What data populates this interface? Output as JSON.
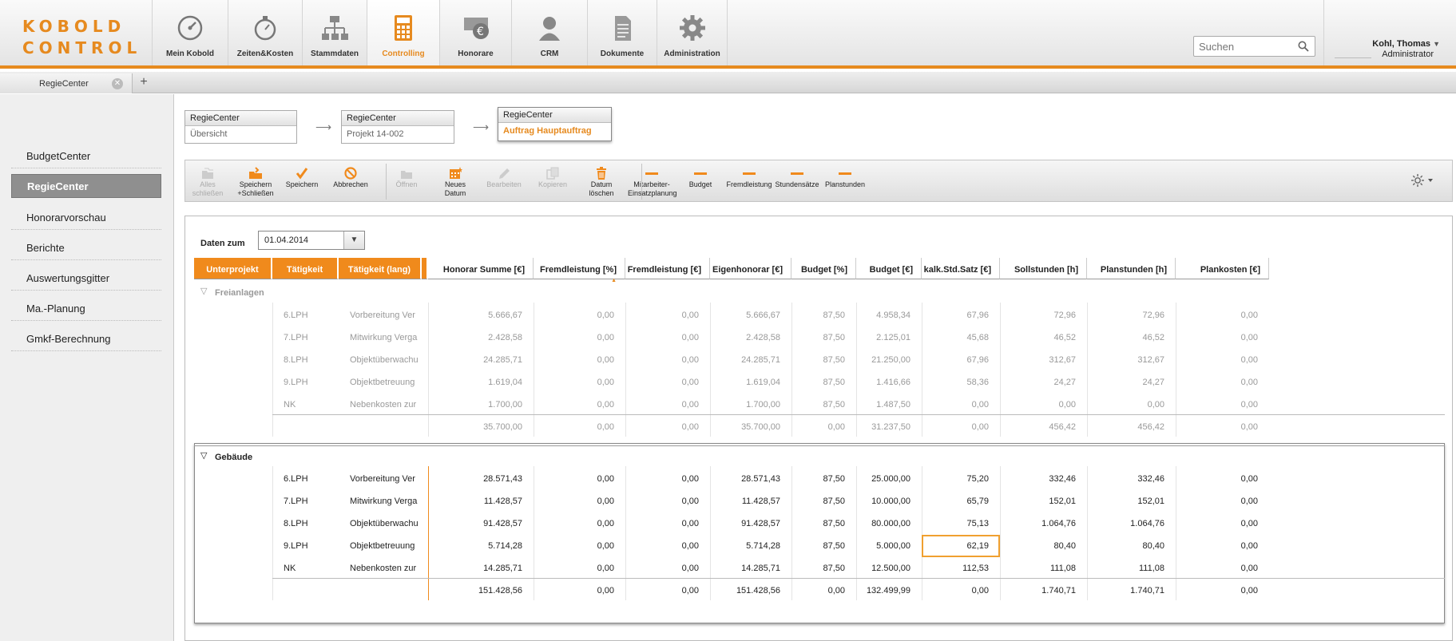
{
  "app": {
    "logo_line1": "KOBOLD",
    "logo_line2": "CONTROL"
  },
  "nav": [
    {
      "label": "Mein Kobold",
      "icon": "speedometer-icon"
    },
    {
      "label": "Zeiten&Kosten",
      "icon": "stopwatch-icon"
    },
    {
      "label": "Stammdaten",
      "icon": "hierarchy-icon"
    },
    {
      "label": "Controlling",
      "icon": "calculator-icon",
      "active": true
    },
    {
      "label": "Honorare",
      "icon": "euro-money-icon"
    },
    {
      "label": "CRM",
      "icon": "person-icon"
    },
    {
      "label": "Dokumente",
      "icon": "document-icon"
    },
    {
      "label": "Administration",
      "icon": "gear-icon"
    }
  ],
  "search": {
    "placeholder": "Suchen"
  },
  "user": {
    "name": "Kohl, Thomas",
    "role": "Administrator"
  },
  "tabs": [
    {
      "label": "RegieCenter"
    }
  ],
  "sidebar": {
    "items": [
      "BudgetCenter",
      "RegieCenter",
      "Honorarvorschau",
      "Berichte",
      "Auswertungsgitter",
      "Ma.-Planung",
      "Gmkf-Berechnung"
    ],
    "active": "RegieCenter"
  },
  "breadcrumb": [
    {
      "title": "RegieCenter",
      "sub": "Übersicht"
    },
    {
      "title": "RegieCenter",
      "sub": "Projekt 14-002"
    },
    {
      "title": "RegieCenter",
      "sub": "Auftrag Hauptauftrag"
    }
  ],
  "toolbar": [
    {
      "l1": "Alles",
      "l2": "schließen",
      "disabled": true,
      "icon": "folders-icon"
    },
    {
      "l1": "Speichern",
      "l2": "+Schließen",
      "disabled": false,
      "icon": "save-close-icon"
    },
    {
      "l1": "Speichern",
      "l2": "",
      "disabled": false,
      "icon": "checkmark-icon"
    },
    {
      "l1": "Abbrechen",
      "l2": "",
      "disabled": false,
      "icon": "cancel-icon"
    },
    {
      "l1": "Öffnen",
      "l2": "",
      "disabled": true,
      "icon": "folder-open-icon"
    },
    {
      "l1": "Neues",
      "l2": "Datum",
      "disabled": false,
      "icon": "new-date-icon"
    },
    {
      "l1": "Bearbeiten",
      "l2": "",
      "disabled": true,
      "icon": "pencil-icon"
    },
    {
      "l1": "Kopieren",
      "l2": "",
      "disabled": true,
      "icon": "copy-icon"
    },
    {
      "l1": "Datum",
      "l2": "löschen",
      "disabled": false,
      "icon": "trash-icon"
    },
    {
      "l1": "Mitarbeiter-",
      "l2": "Einsatzplanung",
      "disabled": false,
      "icon": "dash-icon"
    },
    {
      "l1": "Budget",
      "l2": "",
      "disabled": false,
      "icon": "dash-icon"
    },
    {
      "l1": "Fremdleistung",
      "l2": "",
      "disabled": false,
      "icon": "dash-icon"
    },
    {
      "l1": "Stundensätze",
      "l2": "",
      "disabled": false,
      "icon": "dash-icon"
    },
    {
      "l1": "Planstunden",
      "l2": "",
      "disabled": false,
      "icon": "dash-icon"
    }
  ],
  "filter": {
    "label": "Daten zum",
    "value": "01.04.2014"
  },
  "table": {
    "columns": [
      "Unterprojekt",
      "Tätigkeit",
      "Tätigkeit (lang)",
      "Honorar Summe [€]",
      "Fremdleistung [%]",
      "Fremdleistung [€]",
      "Eigenhonorar [€]",
      "Budget [%]",
      "Budget [€]",
      "kalk.Std.Satz [€]",
      "Sollstunden [h]",
      "Planstunden [h]",
      "Plankosten [€]"
    ],
    "groups": [
      {
        "name": "Freianlagen",
        "rows": [
          [
            "",
            "6.LPH",
            "Vorbereitung Ver",
            "5.666,67",
            "0,00",
            "0,00",
            "5.666,67",
            "87,50",
            "4.958,34",
            "67,96",
            "72,96",
            "72,96",
            "0,00"
          ],
          [
            "",
            "7.LPH",
            "Mitwirkung Verga",
            "2.428,58",
            "0,00",
            "0,00",
            "2.428,58",
            "87,50",
            "2.125,01",
            "45,68",
            "46,52",
            "46,52",
            "0,00"
          ],
          [
            "",
            "8.LPH",
            "Objektüberwachu",
            "24.285,71",
            "0,00",
            "0,00",
            "24.285,71",
            "87,50",
            "21.250,00",
            "67,96",
            "312,67",
            "312,67",
            "0,00"
          ],
          [
            "",
            "9.LPH",
            "Objektbetreuung",
            "1.619,04",
            "0,00",
            "0,00",
            "1.619,04",
            "87,50",
            "1.416,66",
            "58,36",
            "24,27",
            "24,27",
            "0,00"
          ],
          [
            "",
            "NK",
            "Nebenkosten zur",
            "1.700,00",
            "0,00",
            "0,00",
            "1.700,00",
            "87,50",
            "1.487,50",
            "0,00",
            "0,00",
            "0,00",
            "0,00"
          ]
        ],
        "total": [
          "",
          "",
          "",
          "35.700,00",
          "0,00",
          "0,00",
          "35.700,00",
          "0,00",
          "31.237,50",
          "0,00",
          "456,42",
          "456,42",
          "0,00"
        ]
      },
      {
        "name": "Gebäude",
        "rows": [
          [
            "",
            "6.LPH",
            "Vorbereitung Ver",
            "28.571,43",
            "0,00",
            "0,00",
            "28.571,43",
            "87,50",
            "25.000,00",
            "75,20",
            "332,46",
            "332,46",
            "0,00"
          ],
          [
            "",
            "7.LPH",
            "Mitwirkung Verga",
            "11.428,57",
            "0,00",
            "0,00",
            "11.428,57",
            "87,50",
            "10.000,00",
            "65,79",
            "152,01",
            "152,01",
            "0,00"
          ],
          [
            "",
            "8.LPH",
            "Objektüberwachu",
            "91.428,57",
            "0,00",
            "0,00",
            "91.428,57",
            "87,50",
            "80.000,00",
            "75,13",
            "1.064,76",
            "1.064,76",
            "0,00"
          ],
          [
            "",
            "9.LPH",
            "Objektbetreuung",
            "5.714,28",
            "0,00",
            "0,00",
            "5.714,28",
            "87,50",
            "5.000,00",
            "62,19",
            "80,40",
            "80,40",
            "0,00"
          ],
          [
            "",
            "NK",
            "Nebenkosten zur",
            "14.285,71",
            "0,00",
            "0,00",
            "14.285,71",
            "87,50",
            "12.500,00",
            "112,53",
            "111,08",
            "111,08",
            "0,00"
          ]
        ],
        "total": [
          "",
          "",
          "",
          "151.428,56",
          "0,00",
          "0,00",
          "151.428,56",
          "0,00",
          "132.499,99",
          "0,00",
          "1.740,71",
          "1.740,71",
          "0,00"
        ]
      }
    ]
  }
}
